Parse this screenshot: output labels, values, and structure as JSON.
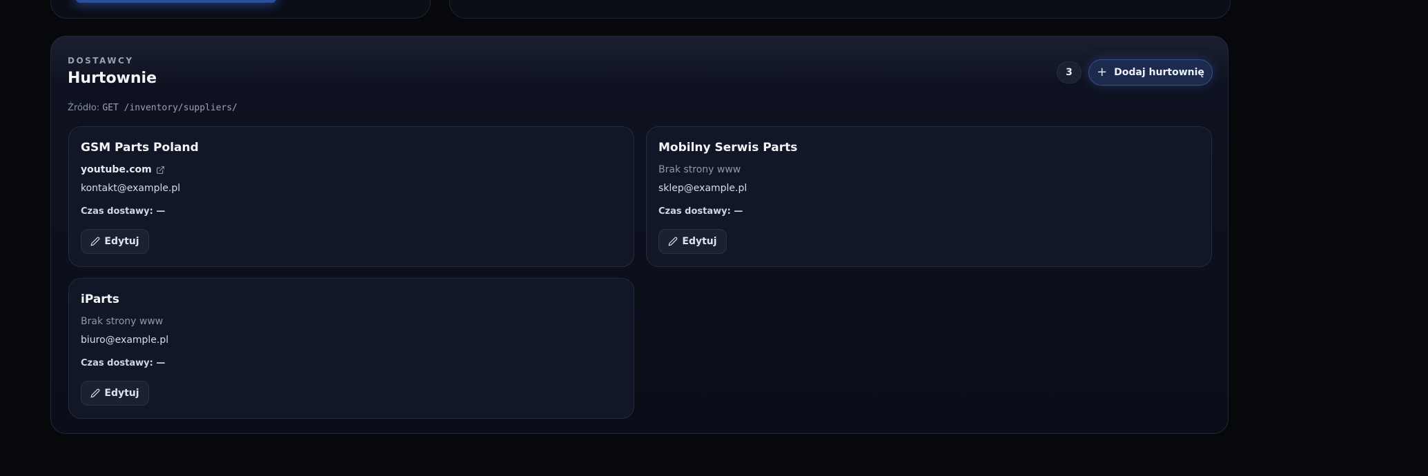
{
  "panel": {
    "eyebrow": "DOSTAWCY",
    "title": "Hurtownie",
    "source_label": "Źródło:",
    "source_endpoint": "GET /inventory/suppliers/",
    "count": "3",
    "add_button_label": "Dodaj hurtownię"
  },
  "suppliers": [
    {
      "name": "GSM Parts Poland",
      "website": "youtube.com",
      "email": "kontakt@example.pl",
      "delivery": "Czas dostawy: —",
      "edit_label": "Edytuj"
    },
    {
      "name": "Mobilny Serwis Parts",
      "website_missing": "Brak strony www",
      "email": "sklep@example.pl",
      "delivery": "Czas dostawy: —",
      "edit_label": "Edytuj"
    },
    {
      "name": "iParts",
      "website_missing": "Brak strony www",
      "email": "biuro@example.pl",
      "delivery": "Czas dostawy: —",
      "edit_label": "Edytuj"
    }
  ],
  "colors": {
    "background": "#07080c",
    "accent": "#36508f"
  }
}
